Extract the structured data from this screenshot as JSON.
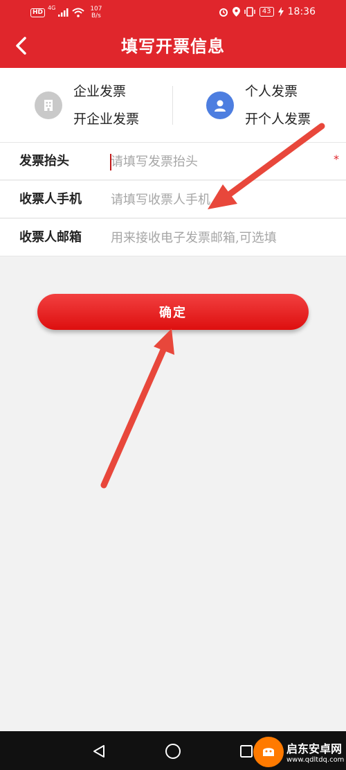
{
  "status_bar": {
    "network": "HD",
    "signal_type": "4G",
    "speed_value": "107",
    "speed_unit": "B/s",
    "battery": "43",
    "time": "18:36"
  },
  "header": {
    "title": "填写开票信息",
    "background_color": "#e0262c"
  },
  "invoice_types": [
    {
      "title": "企业发票",
      "subtitle": "开企业发票",
      "icon": "building-icon",
      "selected": false
    },
    {
      "title": "个人发票",
      "subtitle": "开个人发票",
      "icon": "person-icon",
      "selected": true
    }
  ],
  "form": {
    "title_field": {
      "label": "发票抬头",
      "placeholder": "请填写发票抬头",
      "value": ""
    },
    "phone_field": {
      "label": "收票人手机",
      "placeholder": "请填写收票人手机",
      "value": ""
    },
    "email_field": {
      "label": "收票人邮箱",
      "placeholder": "用来接收电子发票邮箱,可选填",
      "value": ""
    },
    "required_mark": "*"
  },
  "confirm_label": "确定",
  "nav_bar": {
    "back_icon": "triangle-back-icon",
    "home_icon": "circle-home-icon",
    "recents_icon": "square-recents-icon"
  },
  "watermark": {
    "name": "启东安卓网",
    "url": "www.qdltdq.com"
  }
}
